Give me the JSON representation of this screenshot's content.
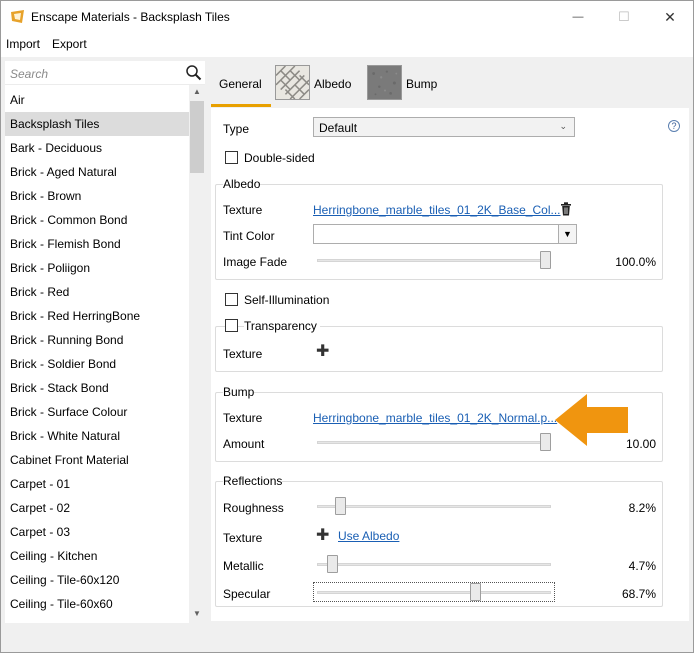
{
  "window": {
    "title": "Enscape Materials - Backsplash Tiles",
    "controls": {
      "minimize": "—",
      "maximize": "☐",
      "close": "✕"
    }
  },
  "menu": {
    "import": "Import",
    "export": "Export"
  },
  "search": {
    "placeholder": "Search"
  },
  "materials": [
    "Air",
    "Backsplash Tiles",
    "Bark - Deciduous",
    "Brick - Aged Natural",
    "Brick - Brown",
    "Brick - Common Bond",
    "Brick - Flemish Bond",
    "Brick - Poliigon",
    "Brick - Red",
    "Brick - Red HerringBone",
    "Brick - Running Bond",
    "Brick - Soldier Bond",
    "Brick - Stack Bond",
    "Brick - Surface Colour",
    "Brick - White Natural",
    "Cabinet Front Material",
    "Carpet - 01",
    "Carpet - 02",
    "Carpet - 03",
    "Ceiling - Kitchen",
    "Ceiling - Tile-60x120",
    "Ceiling - Tile-60x60"
  ],
  "selected_material": "Backsplash Tiles",
  "tabs": {
    "general": "General",
    "albedo": "Albedo",
    "bump": "Bump"
  },
  "general": {
    "type_label": "Type",
    "type_value": "Default",
    "double_sided": "Double-sided",
    "help": "?"
  },
  "albedo": {
    "title": "Albedo",
    "texture_label": "Texture",
    "texture_file": "Herringbone_marble_tiles_01_2K_Base_Col...",
    "tint_label": "Tint Color",
    "fade_label": "Image Fade",
    "fade_value": "100.0%",
    "fade_level": 1.0
  },
  "self_illumination": "Self-Illumination",
  "transparency": {
    "title": "Transparency",
    "texture_label": "Texture"
  },
  "bump": {
    "title": "Bump",
    "texture_label": "Texture",
    "texture_file": "Herringbone_marble_tiles_01_2K_Normal.p...",
    "amount_label": "Amount",
    "amount_value": "10.00",
    "amount_level": 1.0
  },
  "reflections": {
    "title": "Reflections",
    "roughness_label": "Roughness",
    "roughness_value": "8.2%",
    "roughness_level": 0.082,
    "texture_label": "Texture",
    "use_albedo": "Use Albedo",
    "metallic_label": "Metallic",
    "metallic_value": "4.7%",
    "metallic_level": 0.047,
    "specular_label": "Specular",
    "specular_value": "68.7%",
    "specular_level": 0.687
  },
  "colors": {
    "accent": "#e8a000",
    "link": "#1a5fb4",
    "arrow": "#f0950f"
  }
}
